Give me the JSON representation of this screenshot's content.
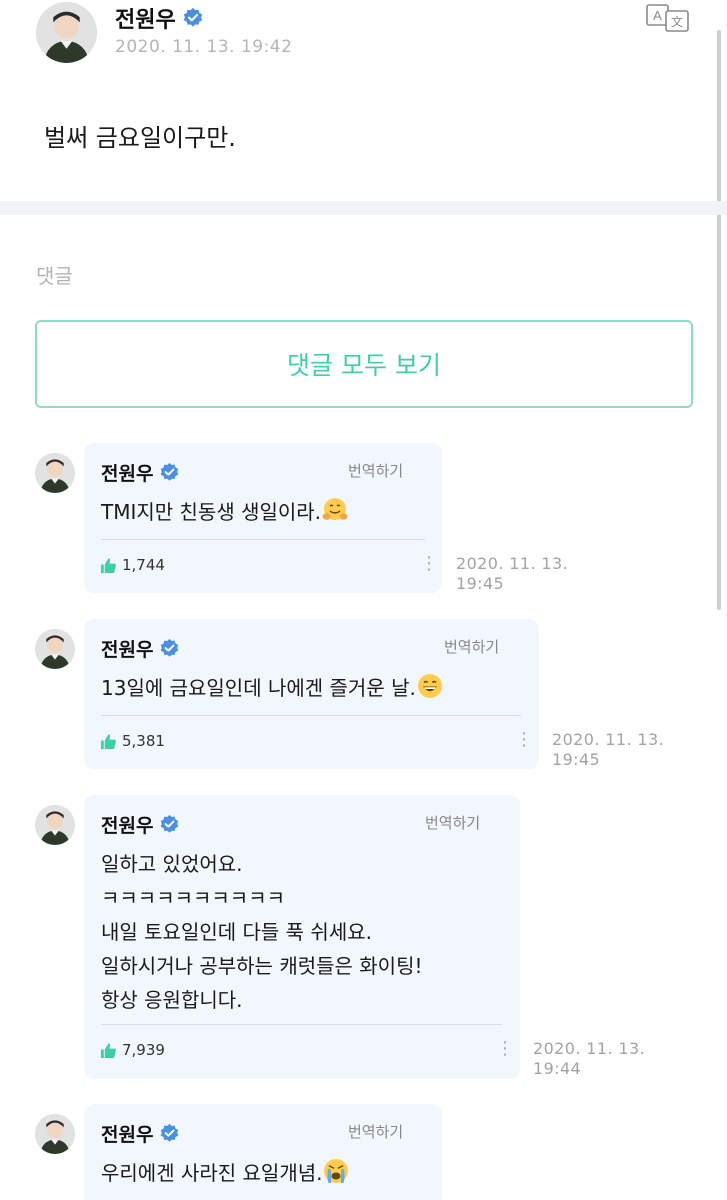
{
  "post": {
    "author": "전원우",
    "date": "2020. 11. 13. 19:42",
    "text": "벌써 금요일이구만.",
    "translate_icon": "translate-icon"
  },
  "comments_section": {
    "heading": "댓글",
    "view_all_label": "댓글 모두 보기"
  },
  "comments": [
    {
      "author": "전원우",
      "translate_label": "번역하기",
      "text": "TMI지만 친동생 생일이라.",
      "emoji": "hugging-face-emoji",
      "likes": "1,744",
      "date_line1": "2020. 11. 13.",
      "date_line2": "19:45"
    },
    {
      "author": "전원우",
      "translate_label": "번역하기",
      "text": "13일에 금요일인데 나에겐 즐거운 날.",
      "emoji": "grinning-face-emoji",
      "likes": "5,381",
      "date_line1": "2020. 11. 13.",
      "date_line2": "19:45"
    },
    {
      "author": "전원우",
      "translate_label": "번역하기",
      "text": "일하고 있었어요.\nㅋㅋㅋㅋㅋㅋㅋㅋㅋㅋ\n내일 토요일인데 다들 푹 쉬세요.\n일하시거나 공부하는 캐럿들은 화이팅!\n항상 응원합니다.",
      "likes": "7,939",
      "date_line1": "2020. 11. 13.",
      "date_line2": "19:44"
    },
    {
      "author": "전원우",
      "translate_label": "번역하기",
      "text": "우리에겐 사라진 요일개념.",
      "emoji": "crying-face-emoji"
    }
  ],
  "colors": {
    "accent": "#3fcfa8",
    "verified": "#4a90e2",
    "bubble": "#f1f7fd",
    "like": "#3fcfa8"
  }
}
